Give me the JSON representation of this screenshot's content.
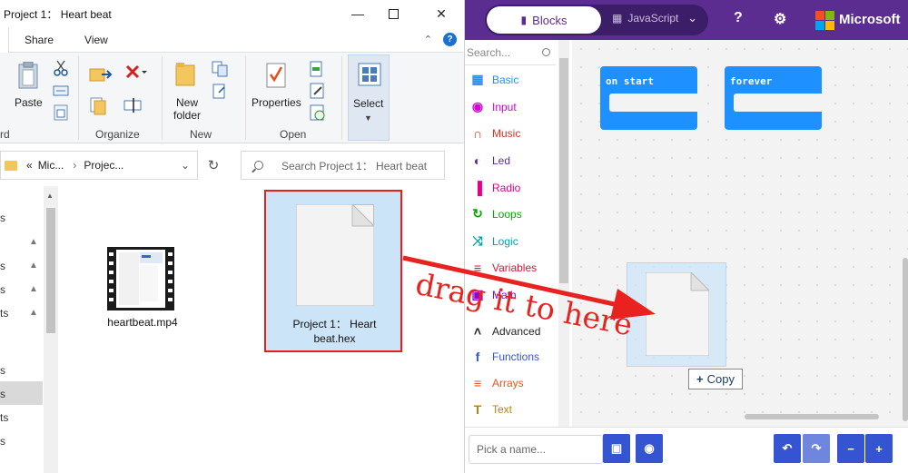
{
  "explorer": {
    "title": "Project 1： Heart beat",
    "ribbon_tabs": [
      "Share",
      "View"
    ],
    "ribbon": {
      "paste": "Paste",
      "new_folder": "New folder",
      "properties": "Properties",
      "select": "Select",
      "groups": {
        "clipboard": "rd",
        "organize": "Organize",
        "new": "New",
        "open": "Open"
      }
    },
    "address": {
      "crumbs": [
        "«",
        "Mic...",
        "Projec..."
      ]
    },
    "search_placeholder": "Search Project 1： Heart beat",
    "nav_items": [
      "s",
      "s",
      "s",
      "ts",
      "s",
      "s",
      "ts",
      "s"
    ],
    "files": [
      {
        "name": "heartbeat.mp4",
        "icon": "video-file-icon"
      },
      {
        "name": "Project 1： Heart beat.hex",
        "icon": "document-file-icon",
        "selected": true
      }
    ]
  },
  "makecode": {
    "mode_blocks": "Blocks",
    "mode_javascript": "JavaScript",
    "brand": "Microsoft",
    "search_placeholder": "Search...",
    "categories": [
      {
        "label": "Basic",
        "color": "#1e90ff",
        "icon": "grid-icon",
        "glyph": "▦"
      },
      {
        "label": "Input",
        "color": "#d400d4",
        "icon": "input-icon",
        "glyph": "◉"
      },
      {
        "label": "Music",
        "color": "#e63022",
        "icon": "headphones-icon",
        "glyph": "∩"
      },
      {
        "label": "Led",
        "color": "#5c2d91",
        "icon": "toggle-icon",
        "glyph": "◐"
      },
      {
        "label": "Radio",
        "color": "#e3008c",
        "icon": "signal-icon",
        "glyph": "▐"
      },
      {
        "label": "Loops",
        "color": "#00aa00",
        "icon": "refresh-icon",
        "glyph": "↻"
      },
      {
        "label": "Logic",
        "color": "#00a4a6",
        "icon": "shuffle-icon",
        "glyph": "⤨"
      },
      {
        "label": "Variables",
        "color": "#dc143c",
        "icon": "list-icon",
        "glyph": "≡"
      },
      {
        "label": "Math",
        "color": "#9400d3",
        "icon": "calculator-icon",
        "glyph": "▣"
      },
      {
        "label": "Advanced",
        "color": "#222222",
        "icon": "chevron-up-icon",
        "glyph": "˄"
      },
      {
        "label": "Functions",
        "color": "#3455db",
        "icon": "function-icon",
        "glyph": "f"
      },
      {
        "label": "Arrays",
        "color": "#e65722",
        "icon": "list-icon",
        "glyph": "≡"
      },
      {
        "label": "Text",
        "color": "#b8860b",
        "icon": "text-icon",
        "glyph": "T"
      }
    ],
    "blocks": {
      "on_start": "on start",
      "forever": "forever"
    },
    "copy_badge": "Copy",
    "name_placeholder": "Pick a name..."
  },
  "annotation": {
    "text": "drag it to here",
    "color": "#e8231f"
  }
}
